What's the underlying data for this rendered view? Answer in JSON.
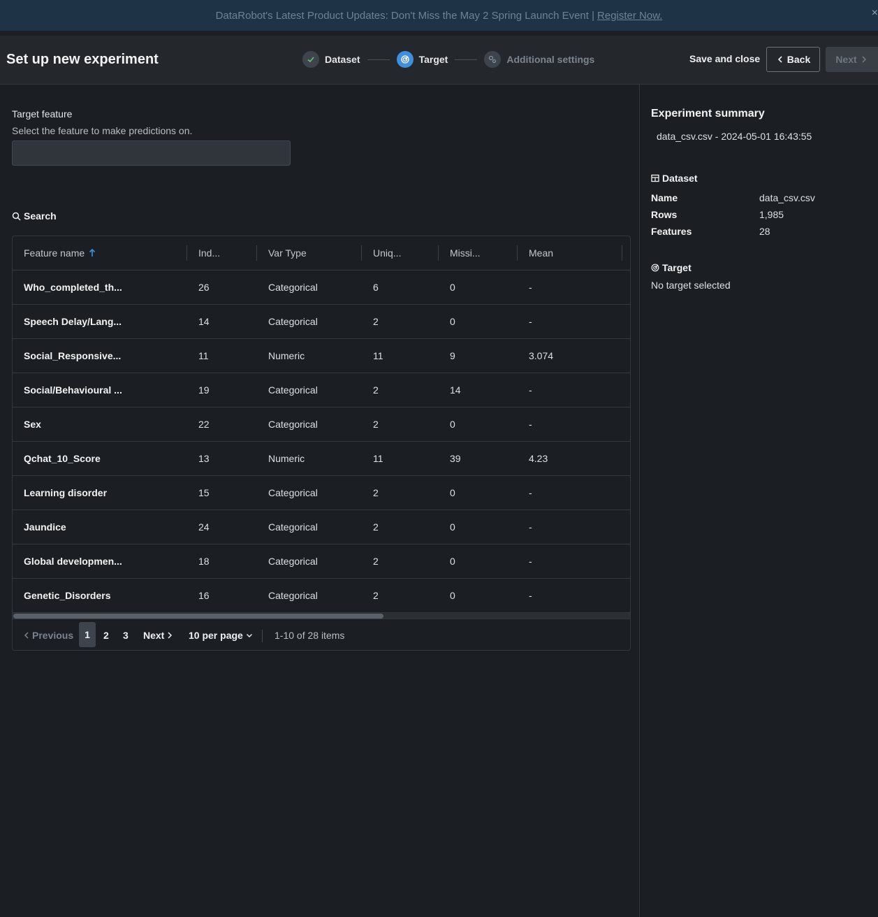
{
  "banner": {
    "text": "DataRobot's Latest Product Updates: Don't Miss the May 2 Spring Launch Event |",
    "link": "Register Now."
  },
  "header": {
    "title": "Set up new experiment",
    "steps": [
      {
        "label": "Dataset",
        "state": "done"
      },
      {
        "label": "Target",
        "state": "active"
      },
      {
        "label": "Additional settings",
        "state": "pending"
      }
    ],
    "save_close": "Save and close",
    "back": "Back",
    "next": "Next"
  },
  "target": {
    "label": "Target feature",
    "help": "Select the feature to make predictions on.",
    "value": ""
  },
  "search_label": "Search",
  "table": {
    "columns": [
      "Feature name",
      "Ind...",
      "Var Type",
      "Uniq...",
      "Missi...",
      "Mean"
    ],
    "rows": [
      [
        "Who_completed_th...",
        "26",
        "Categorical",
        "6",
        "0",
        "-"
      ],
      [
        "Speech Delay/Lang...",
        "14",
        "Categorical",
        "2",
        "0",
        "-"
      ],
      [
        "Social_Responsive...",
        "11",
        "Numeric",
        "11",
        "9",
        "3.074"
      ],
      [
        "Social/Behavioural ...",
        "19",
        "Categorical",
        "2",
        "14",
        "-"
      ],
      [
        "Sex",
        "22",
        "Categorical",
        "2",
        "0",
        "-"
      ],
      [
        "Qchat_10_Score",
        "13",
        "Numeric",
        "11",
        "39",
        "4.23"
      ],
      [
        "Learning disorder",
        "15",
        "Categorical",
        "2",
        "0",
        "-"
      ],
      [
        "Jaundice",
        "24",
        "Categorical",
        "2",
        "0",
        "-"
      ],
      [
        "Global developmen...",
        "18",
        "Categorical",
        "2",
        "0",
        "-"
      ],
      [
        "Genetic_Disorders",
        "16",
        "Categorical",
        "2",
        "0",
        "-"
      ]
    ]
  },
  "pager": {
    "previous": "Previous",
    "pages": [
      "1",
      "2",
      "3"
    ],
    "current_page": 1,
    "next": "Next",
    "per_page": "10 per page",
    "count": "1-10 of 28 items"
  },
  "summary": {
    "title": "Experiment summary",
    "subtitle": "data_csv.csv - 2024-05-01 16:43:55",
    "dataset_title": "Dataset",
    "dataset": [
      {
        "key": "Name",
        "value": "data_csv.csv"
      },
      {
        "key": "Rows",
        "value": "1,985"
      },
      {
        "key": "Features",
        "value": "28"
      }
    ],
    "target_title": "Target",
    "target_value": "No target selected"
  },
  "colors": {
    "accent": "#3f8fe0",
    "background": "#1b1f23",
    "banner": "#1f3347"
  }
}
